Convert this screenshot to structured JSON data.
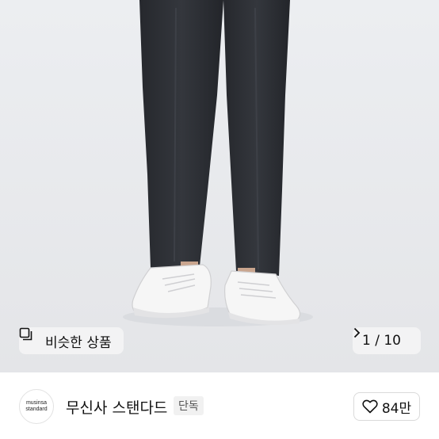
{
  "product_image": {
    "similar_button_label": "비슷한 상품",
    "image_counter": "1 / 10",
    "similar_icon": "similar-products-icon",
    "next_icon": "chevron-right-icon"
  },
  "brand": {
    "logo_line1": "musinsa",
    "logo_line2": "standard",
    "name": "무신사 스탠다드",
    "badge": "단독"
  },
  "like": {
    "icon": "heart-outline-icon",
    "count": "84만"
  }
}
